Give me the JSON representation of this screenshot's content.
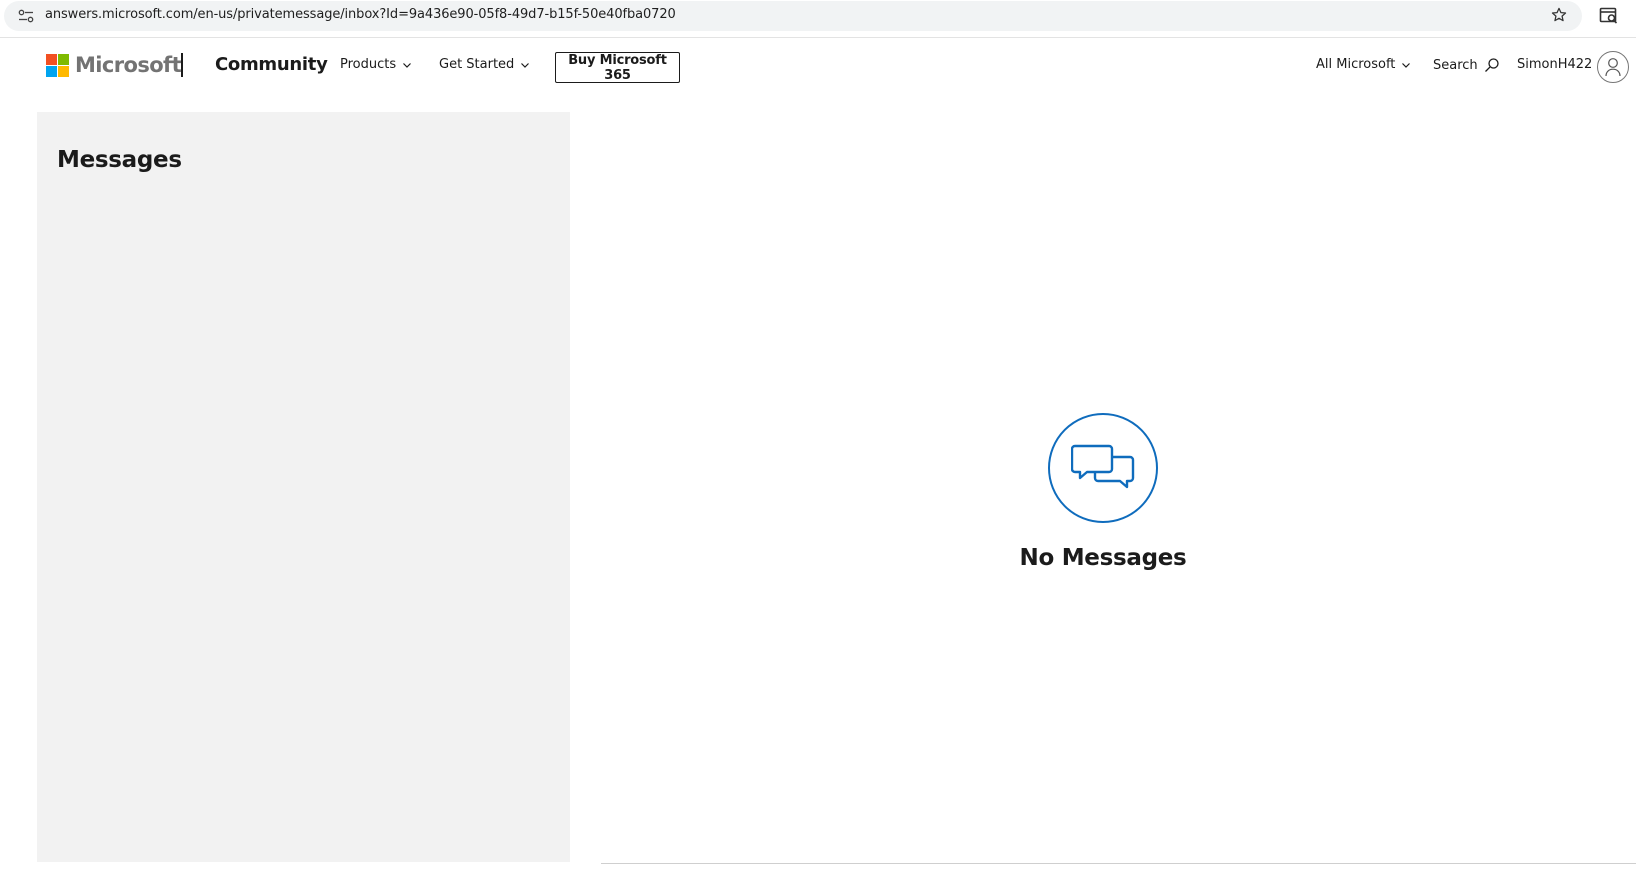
{
  "browser": {
    "url": "answers.microsoft.com/en-us/privatemessage/inbox?Id=9a436e90-05f8-49d7-b15f-50e40fba0720"
  },
  "header": {
    "brand": "Microsoft",
    "site_name": "Community",
    "nav": {
      "products": "Products",
      "get_started": "Get Started"
    },
    "buy_button": "Buy Microsoft 365",
    "all_microsoft": "All Microsoft",
    "search": "Search",
    "username": "SimonH422"
  },
  "sidebar": {
    "title": "Messages"
  },
  "main": {
    "empty_state_title": "No Messages",
    "empty_state_icon": "chat-bubbles-icon"
  },
  "colors": {
    "accent": "#0f6cbd",
    "sidebar_bg": "#f2f2f2",
    "logo_red": "#f25022",
    "logo_green": "#7fba00",
    "logo_blue": "#00a4ef",
    "logo_yellow": "#ffb900"
  }
}
